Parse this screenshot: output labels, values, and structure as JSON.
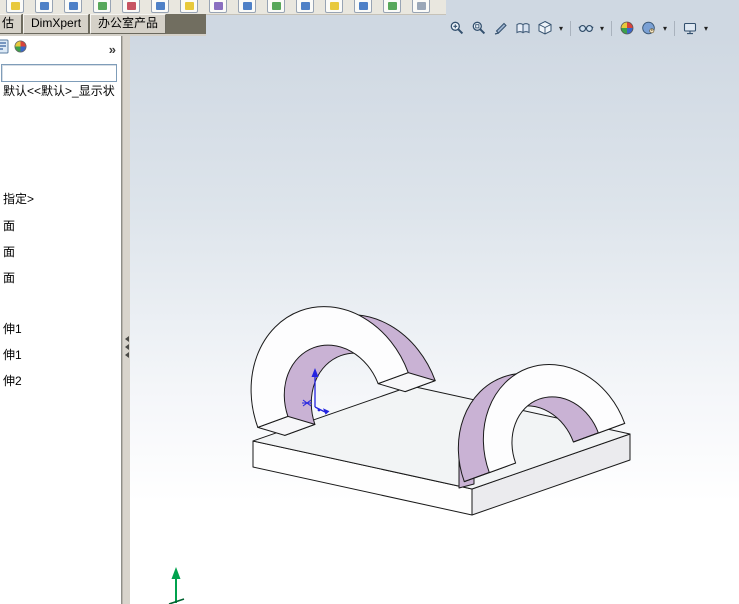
{
  "command_tabs": {
    "items": [
      {
        "label": "估"
      },
      {
        "label": "DimXpert"
      },
      {
        "label": "办公室产品"
      }
    ]
  },
  "heads_up_toolbar": {
    "icon_names": [
      "zoom-to-fit-icon",
      "zoom-to-area-icon",
      "section-view-icon",
      "view-orientation-icon",
      "display-style-icon",
      "hide-show-items-icon",
      "edit-appearance-icon",
      "apply-scene-icon",
      "view-settings-icon"
    ]
  },
  "left_panel": {
    "overflow_chevron": "»",
    "tree": {
      "display_state_label": "默认<<默认>_显示状",
      "items": [
        "指定>",
        "面",
        "面",
        "面",
        "伸1",
        "伸1",
        "伸2"
      ]
    }
  },
  "viewport": {
    "colors": {
      "background_top": "#cfd8e2",
      "background_bottom": "#ffffff",
      "model_face": "#ffffff",
      "model_accent_face": "#c9b2d4",
      "model_edge": "#1a1a1a",
      "origin_marker": "#2424e0",
      "triad_y_axis": "#00a24d"
    }
  }
}
